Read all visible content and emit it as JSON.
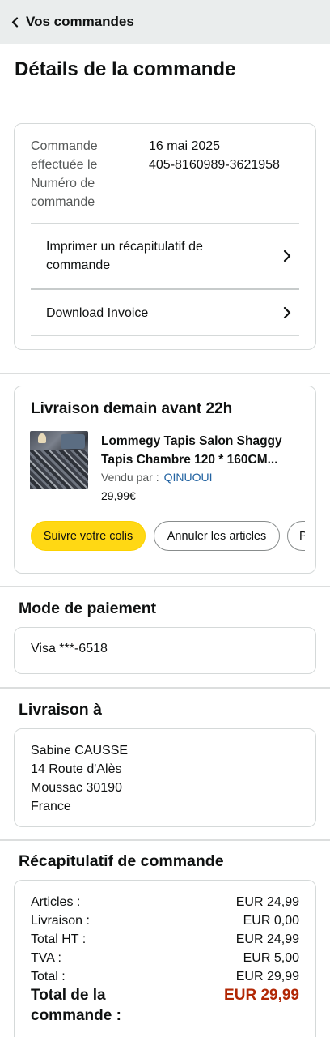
{
  "header": {
    "back_icon": "chevron-left-icon",
    "title": "Vos commandes"
  },
  "page_title": "Détails de la commande",
  "order_info": {
    "labels": "Commande effectuée le Numéro de commande",
    "label_lines": [
      "Commande",
      "effectuée le",
      "Numéro de",
      "commande"
    ],
    "date": "16 mai 2025",
    "number": "405-8160989-3621958",
    "print_summary": "Imprimer un récapitulatif de commande",
    "print_summary_lines": [
      "Imprimer un récapitulatif de",
      "commande"
    ],
    "download_invoice": "Download Invoice"
  },
  "delivery": {
    "heading": "Livraison demain avant 22h",
    "product": {
      "title_line1": "Lommegy Tapis Salon Shaggy",
      "title_line2": "Tapis Chambre 120 * 160CM...",
      "sold_by_label": "Vendu par :",
      "seller": "QINUOUI",
      "price": "29,99€"
    },
    "buttons": {
      "track": "Suivre votre colis",
      "cancel": "Annuler les articles",
      "third_partial": "P"
    }
  },
  "payment": {
    "heading": "Mode de paiement",
    "method": "Visa ***-6518"
  },
  "shipping": {
    "heading": "Livraison à",
    "name": "Sabine CAUSSE",
    "street": "14 Route d'Alès",
    "city": "Moussac 30190",
    "country": "France"
  },
  "summary": {
    "heading": "Récapitulatif de commande",
    "rows": [
      {
        "label": "Articles :",
        "value": "EUR 24,99"
      },
      {
        "label": "Livraison :",
        "value": "EUR 0,00"
      },
      {
        "label": "Total HT :",
        "value": "EUR 24,99"
      },
      {
        "label": "TVA :",
        "value": "EUR 5,00"
      },
      {
        "label": "Total :",
        "value": "EUR 29,99"
      }
    ],
    "total_label": "Total de la commande :",
    "total_value": "EUR 29,99"
  },
  "colors": {
    "header_bg": "#eaeded",
    "primary_button": "#ffd814",
    "seller_link": "#2162a1",
    "total_price": "#b12704"
  }
}
